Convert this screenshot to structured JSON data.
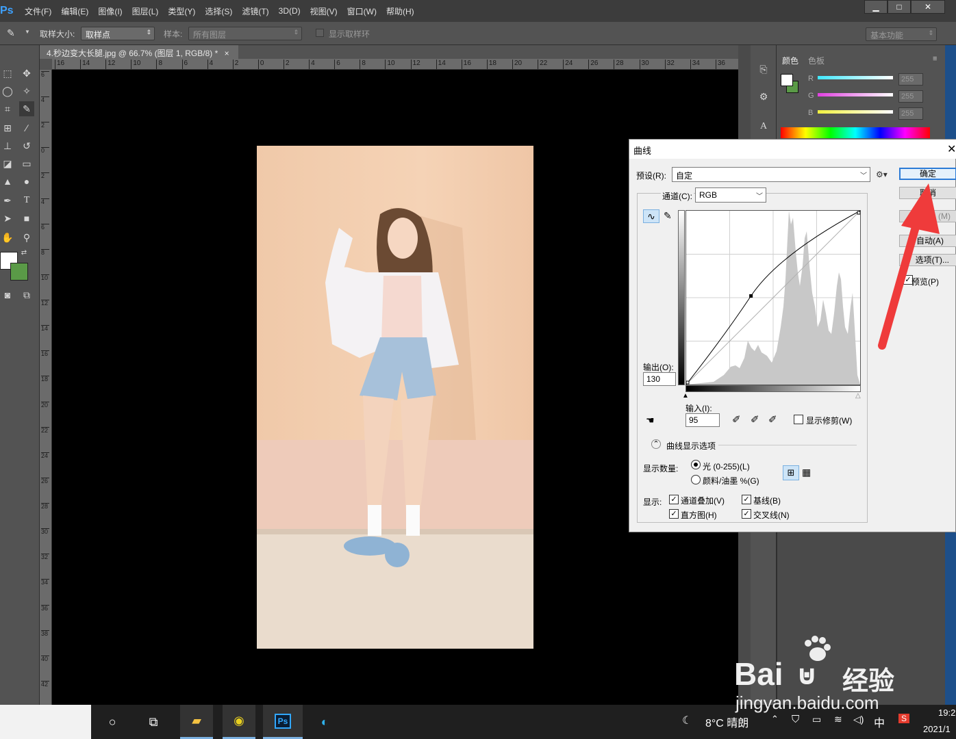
{
  "app": {
    "logo": "Ps",
    "menu": [
      "文件(F)",
      "编辑(E)",
      "图像(I)",
      "图层(L)",
      "类型(Y)",
      "选择(S)",
      "滤镜(T)",
      "3D(D)",
      "视图(V)",
      "窗口(W)",
      "帮助(H)"
    ],
    "window_buttons": [
      "▁",
      "□",
      "✕"
    ]
  },
  "options_bar": {
    "sample_size_label": "取样大小:",
    "sample_size_value": "取样点",
    "sample_label": "样本:",
    "sample_value": "所有图层",
    "show_ring_label": "显示取样环",
    "workspace": "基本功能"
  },
  "document": {
    "tab_title": "4.秒边变大长腿.jpg @ 66.7% (图层 1, RGB/8) *",
    "tab_close": "×",
    "ruler_h_ticks": [
      "16",
      "14",
      "12",
      "10",
      "8",
      "6",
      "4",
      "2",
      "0",
      "2",
      "4",
      "6",
      "8",
      "10",
      "12",
      "14",
      "16",
      "18",
      "20",
      "22",
      "24",
      "26",
      "28",
      "30",
      "32",
      "34",
      "36"
    ],
    "ruler_v_ticks": [
      "6",
      "4",
      "2",
      "0",
      "2",
      "4",
      "6",
      "8",
      "10",
      "12",
      "14",
      "16",
      "18",
      "20",
      "22",
      "24",
      "26",
      "28",
      "30",
      "32",
      "34",
      "36",
      "38",
      "40",
      "42"
    ]
  },
  "color_panel": {
    "tabs": [
      "颜色",
      "色板"
    ],
    "channels": [
      {
        "label": "R",
        "value": "255",
        "color": "#40e8ff"
      },
      {
        "label": "G",
        "value": "255",
        "color": "#e040e0"
      },
      {
        "label": "B",
        "value": "255",
        "color": "#f0f040"
      }
    ]
  },
  "curves_dialog": {
    "title": "曲线",
    "preset_label": "预设(R):",
    "preset_value": "自定",
    "channel_label": "通道(C):",
    "channel_value": "RGB",
    "output_label": "输出(O):",
    "output_value": "130",
    "input_label": "输入(I):",
    "input_value": "95",
    "show_clipping": "显示修剪(W)",
    "display_options": "曲线显示选项",
    "show_amount_label": "显示数量:",
    "radio_light": "光 (0-255)(L)",
    "radio_pigment": "颜料/油墨 %(G)",
    "show_label": "显示:",
    "cb_channel_overlay": "通道叠加(V)",
    "cb_baseline": "基线(B)",
    "cb_histogram": "直方图(H)",
    "cb_intersection": "交叉线(N)",
    "btn_ok": "确定",
    "btn_cancel": "取消",
    "btn_smooth": "(M)",
    "btn_auto": "自动(A)",
    "btn_options": "选项(T)...",
    "preview_label": "预览(P)",
    "checkmark": "✓",
    "control_point": {
      "input": 95,
      "output": 130
    }
  },
  "taskbar": {
    "weather": "8°C 晴朗",
    "ime": "中",
    "time": "19:2",
    "date": "2021/1"
  },
  "watermark": {
    "brand": "Bai",
    "brand2": "经验",
    "url": "jingyan.baidu.com"
  }
}
